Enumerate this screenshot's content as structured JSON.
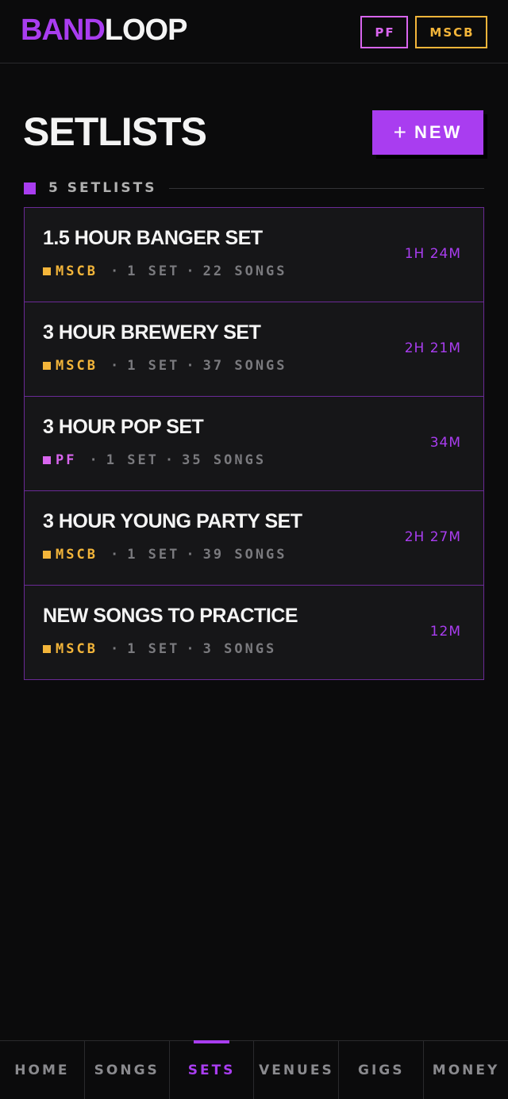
{
  "header": {
    "logo_part1": "BAND",
    "logo_part2": "LOOP",
    "chips": [
      "PF",
      "MSCB"
    ]
  },
  "page": {
    "title": "SETLISTS",
    "new_button": "NEW",
    "count_label": "5 SETLISTS"
  },
  "setlists": [
    {
      "name": "1.5 HOUR BANGER SET",
      "band": "MSCB",
      "band_color": "#f3b53a",
      "sets": "1 SET",
      "songs": "22 SONGS",
      "duration": "1H 24M"
    },
    {
      "name": "3 HOUR BREWERY SET",
      "band": "MSCB",
      "band_color": "#f3b53a",
      "sets": "1 SET",
      "songs": "37 SONGS",
      "duration": "2H 21M"
    },
    {
      "name": "3 HOUR POP SET",
      "band": "PF",
      "band_color": "#d865ee",
      "sets": "1 SET",
      "songs": "35 SONGS",
      "duration": "34M"
    },
    {
      "name": "3 HOUR YOUNG PARTY SET",
      "band": "MSCB",
      "band_color": "#f3b53a",
      "sets": "1 SET",
      "songs": "39 SONGS",
      "duration": "2H 27M"
    },
    {
      "name": "NEW SONGS TO PRACTICE",
      "band": "MSCB",
      "band_color": "#f3b53a",
      "sets": "1 SET",
      "songs": "3 SONGS",
      "duration": "12M"
    }
  ],
  "nav": {
    "tabs": [
      "HOME",
      "SONGS",
      "SETS",
      "VENUES",
      "GIGS",
      "MONEY"
    ],
    "active": "SETS"
  },
  "colors": {
    "accent": "#a93df0",
    "mscb": "#f3b53a",
    "pf": "#d865ee"
  }
}
